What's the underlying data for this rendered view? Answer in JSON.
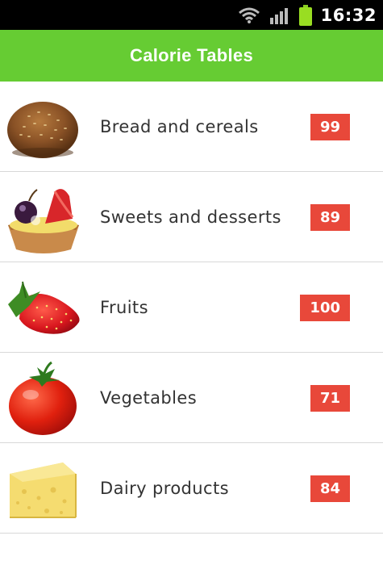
{
  "status_bar": {
    "time": "16:32",
    "icons": [
      "wifi-icon",
      "signal-icon",
      "battery-icon"
    ]
  },
  "app_bar": {
    "title": "Calorie Tables"
  },
  "categories": [
    {
      "label": "Bread and cereals",
      "count": "99",
      "icon": "bread-roll-icon"
    },
    {
      "label": "Sweets and desserts",
      "count": "89",
      "icon": "fruit-tart-icon"
    },
    {
      "label": "Fruits",
      "count": "100",
      "icon": "strawberry-icon"
    },
    {
      "label": "Vegetables",
      "count": "71",
      "icon": "tomato-icon"
    },
    {
      "label": "Dairy products",
      "count": "84",
      "icon": "cheese-icon"
    }
  ],
  "colors": {
    "accent": "#66cc33",
    "badge": "#e8483a"
  }
}
